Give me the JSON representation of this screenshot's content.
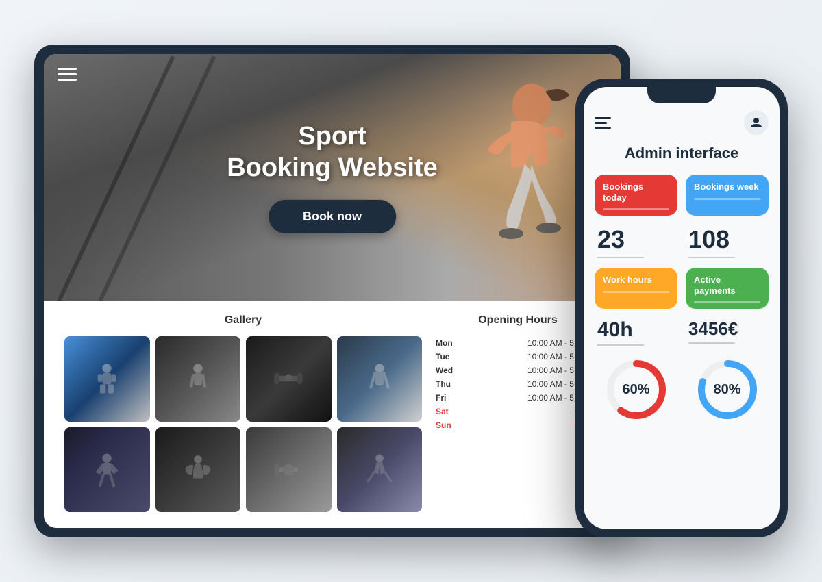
{
  "scene": {
    "laptop": {
      "hero": {
        "title_line1": "Sport",
        "title_line2": "Booking Website",
        "book_btn": "Book now"
      },
      "gallery": {
        "section_title": "Gallery",
        "images": [
          {
            "id": 1,
            "class": "gym-img-1",
            "emoji": "🏋️"
          },
          {
            "id": 2,
            "class": "gym-img-2",
            "emoji": "💪"
          },
          {
            "id": 3,
            "class": "gym-img-3",
            "emoji": "🥊"
          },
          {
            "id": 4,
            "class": "gym-img-4",
            "emoji": "🏃"
          },
          {
            "id": 5,
            "class": "gym-img-5",
            "emoji": "🏋️"
          },
          {
            "id": 6,
            "class": "gym-img-6",
            "emoji": "🤸"
          },
          {
            "id": 7,
            "class": "gym-img-7",
            "emoji": "💪"
          },
          {
            "id": 8,
            "class": "gym-img-8",
            "emoji": "🏃"
          }
        ]
      },
      "opening_hours": {
        "section_title": "Opening Hours",
        "days": [
          {
            "day": "Mon",
            "hours": "10:00 AM - 5:00 PM",
            "closed": false
          },
          {
            "day": "Tue",
            "hours": "10:00 AM - 5:00 PM",
            "closed": false
          },
          {
            "day": "Wed",
            "hours": "10:00 AM - 5:00 PM",
            "closed": false
          },
          {
            "day": "Thu",
            "hours": "10:00 AM - 5:00 PM",
            "closed": false
          },
          {
            "day": "Fri",
            "hours": "10:00 AM - 5:00 PM",
            "closed": false
          },
          {
            "day": "Sat",
            "hours": "Closed",
            "closed": true
          },
          {
            "day": "Sun",
            "hours": "Closed",
            "closed": true
          }
        ]
      }
    },
    "phone": {
      "header": {
        "user_icon": "👤"
      },
      "admin_title": "Admin interface",
      "stats": [
        {
          "label": "Bookings today",
          "color": "red",
          "value": "23"
        },
        {
          "label": "Bookings week",
          "color": "blue",
          "value": "108"
        },
        {
          "label": "Work hours",
          "color": "orange",
          "value": "40h"
        },
        {
          "label": "Active payments",
          "color": "green",
          "value": "3456€"
        }
      ],
      "charts": [
        {
          "label": "60%",
          "percentage": 60,
          "color": "#e53935",
          "bg": "#eee"
        },
        {
          "label": "80%",
          "percentage": 80,
          "color": "#42a5f5",
          "bg": "#eee"
        }
      ]
    }
  }
}
